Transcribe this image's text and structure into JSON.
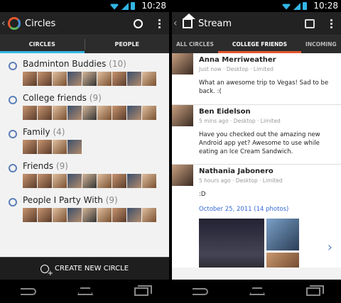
{
  "status": {
    "time": "10:28"
  },
  "left": {
    "actionbar": {
      "title": "Circles"
    },
    "tabs": [
      {
        "label": "CIRCLES",
        "selected": true
      },
      {
        "label": "PEOPLE",
        "selected": false
      }
    ],
    "circles": [
      {
        "name": "Badminton Buddies",
        "count": "(10)",
        "thumbs": 9
      },
      {
        "name": "College friends",
        "count": "(9)",
        "thumbs": 9
      },
      {
        "name": "Family",
        "count": "(4)",
        "thumbs": 4
      },
      {
        "name": "Friends",
        "count": "(9)",
        "thumbs": 9
      },
      {
        "name": "People I Party With",
        "count": "(9)",
        "thumbs": 9
      }
    ],
    "create_label": "CREATE NEW CIRCLE"
  },
  "right": {
    "actionbar": {
      "title": "Stream"
    },
    "tabs": [
      "ALL CIRCLES",
      "COLLEGE FRIENDS",
      "INCOMING"
    ],
    "selected_tab": "COLLEGE FRIENDS",
    "posts": [
      {
        "author": "Anna Merriweather",
        "meta": "Just now · Desktop · Limited",
        "text": "What an awesome trip to Vegas! Sad to be back. :("
      },
      {
        "author": "Ben Eidelson",
        "meta": "5 mins ago · Desktop · Limited",
        "text": "Have you checked out the amazing new Android app yet? Awesome to use while eating an Ice Cream Sandwich."
      },
      {
        "author": "Nathania Jabonero",
        "meta": "5 hours ago · Desktop · Limited",
        "text": ":D",
        "album": "October 25, 2011 (14 photos)"
      }
    ]
  },
  "colors": {
    "accent": "#33b5e5",
    "stream_tab_accent": "#e4572e",
    "link": "#3367d6"
  }
}
